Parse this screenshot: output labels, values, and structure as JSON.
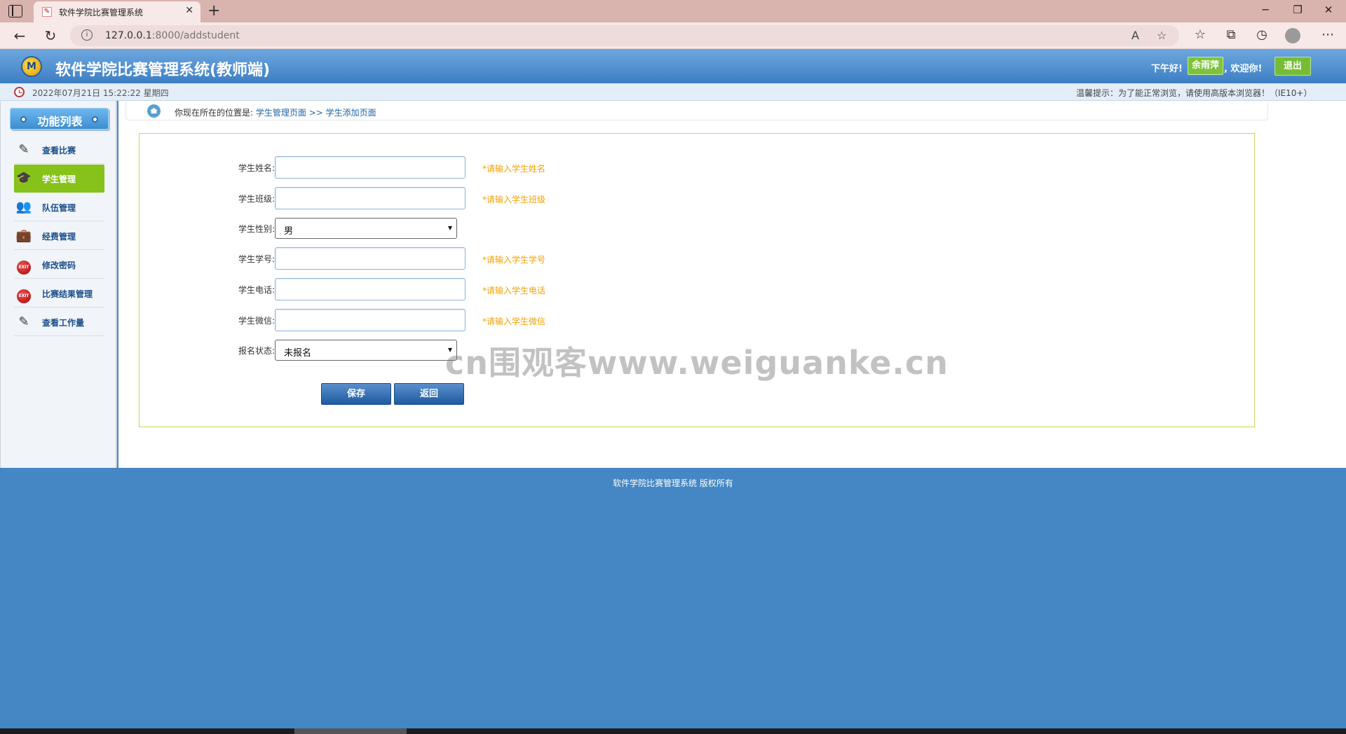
{
  "browser": {
    "tab_title": "软件学院比赛管理系统",
    "url_host": "127.0.0.1",
    "url_rest": ":8000/addstudent"
  },
  "header": {
    "title": "软件学院比赛管理系统(教师端)",
    "greeting": "下午好!",
    "username": "余雨萍",
    "welcome": ", 欢迎你!",
    "logout": "退出"
  },
  "infobar": {
    "datetime": "2022年07月21日 15:22:22 星期四",
    "tip": "温馨提示：为了能正常浏览，请使用高版本浏览器！（IE10+）"
  },
  "sidebar": {
    "heading": "功能列表",
    "items": [
      {
        "label": "查看比赛",
        "icon": "pencil-book-icon"
      },
      {
        "label": "学生管理",
        "icon": "student-icon",
        "active": true
      },
      {
        "label": "队伍管理",
        "icon": "team-icon"
      },
      {
        "label": "经费管理",
        "icon": "funds-icon"
      },
      {
        "label": "修改密码",
        "icon": "exit-icon"
      },
      {
        "label": "比赛结果管理",
        "icon": "exit-icon"
      },
      {
        "label": "查看工作量",
        "icon": "pencil-book-icon"
      }
    ]
  },
  "breadcrumb": {
    "prefix": "你现在所在的位置是:",
    "link1": "学生管理页面",
    "sep": ">>",
    "link2": "学生添加页面"
  },
  "form": {
    "name_label": "学生姓名:",
    "name_hint": "*请输入学生姓名",
    "class_label": "学生班级:",
    "class_hint": "*请输入学生班级",
    "gender_label": "学生性别:",
    "gender_value": "男",
    "number_label": "学生学号:",
    "number_hint": "*请输入学生学号",
    "phone_label": "学生电话:",
    "phone_hint": "*请输入学生电话",
    "wechat_label": "学生微信:",
    "wechat_hint": "*请输入学生微信",
    "status_label": "报名状态:",
    "status_value": "未报名",
    "save": "保存",
    "back": "返回"
  },
  "footer": {
    "text": "软件学院比赛管理系统 版权所有"
  },
  "watermark": "cn围观客www.weiguanke.cn",
  "colors": {
    "header_blue": "#3c7ec4",
    "active_green": "#86c21a",
    "hint_orange": "#f0a20a",
    "footer_blue": "#4487c4"
  }
}
